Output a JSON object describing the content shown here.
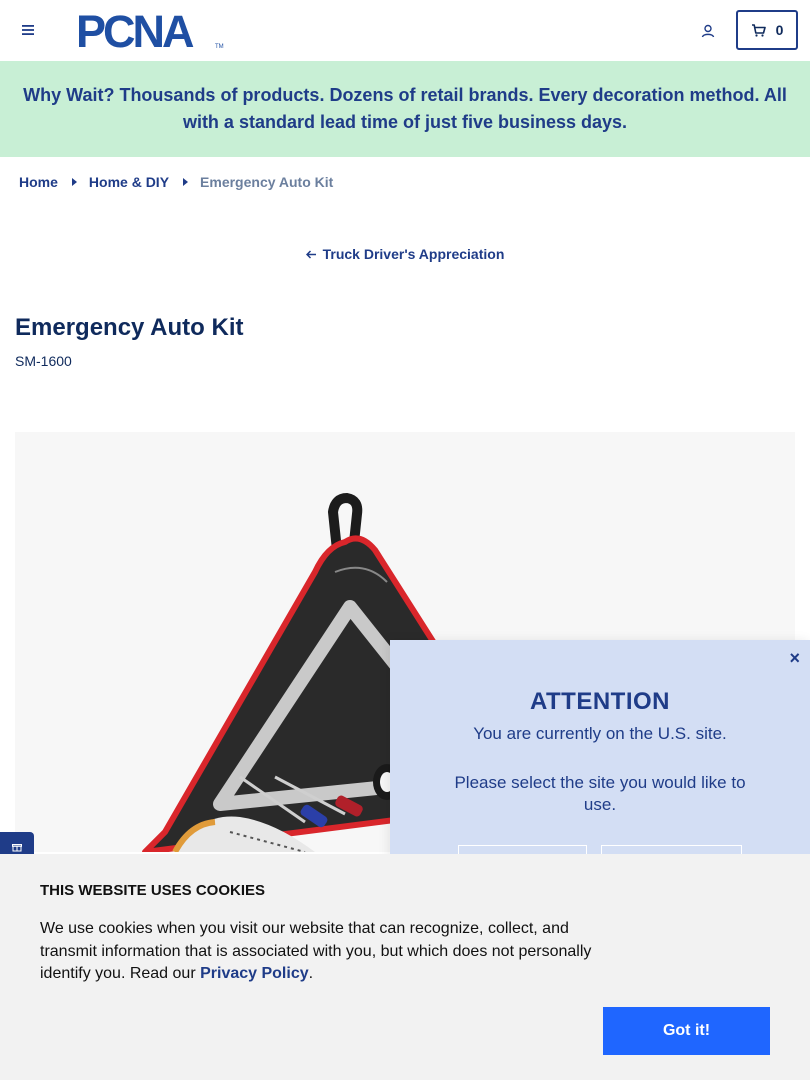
{
  "header": {
    "logo_text": "PCNA",
    "logo_tm": "TM",
    "cart_count": "0"
  },
  "promo": {
    "text": "Why Wait? Thousands of products. Dozens of retail brands. Every decoration method. All with a standard lead time of just five business days."
  },
  "breadcrumb": {
    "items": [
      "Home",
      "Home & DIY"
    ],
    "current": "Emergency Auto Kit"
  },
  "back_link": {
    "label": "Truck Driver's Appreciation"
  },
  "product": {
    "title": "Emergency Auto Kit",
    "sku": "SM-1600"
  },
  "modal": {
    "close": "×",
    "title": "ATTENTION",
    "line1": "You are currently on the U.S. site.",
    "line2": "Please select the site you would like to use."
  },
  "cookie": {
    "title": "THIS WEBSITE USES COOKIES",
    "text_before": "We use cookies when you visit our website that can recognize, collect, and transmit information that is associated with you, but which does not personally identify you. Read our ",
    "link": "Privacy Policy",
    "text_after": ".",
    "button": "Got it!"
  },
  "side_tab": {
    "icon": "gift-icon"
  },
  "colors": {
    "brand_navy": "#1f3c88",
    "promo_bg": "#c8efd5",
    "modal_bg": "#d3def4",
    "cta_blue": "#1f66ff"
  }
}
